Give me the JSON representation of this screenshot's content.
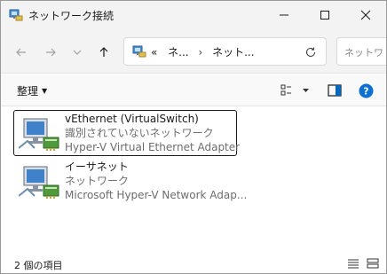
{
  "window": {
    "title": "ネットワーク接続"
  },
  "nav": {
    "breadcrumb": [
      "«",
      "ネ...",
      "ネット..."
    ],
    "search_placeholder": "ネットワ"
  },
  "toolbar": {
    "organize_label": "整理"
  },
  "items": [
    {
      "name": "vEthernet (VirtualSwitch)",
      "status": "識別されていないネットワーク",
      "adapter": "Hyper-V Virtual Ethernet Adapter"
    },
    {
      "name": "イーサネット",
      "status": "ネットワーク",
      "adapter": "Microsoft Hyper-V Network Adap..."
    }
  ],
  "status": {
    "count_text": "2 個の項目"
  },
  "colors": {
    "accent": "#0067c0",
    "help": "#0a6fd6"
  }
}
